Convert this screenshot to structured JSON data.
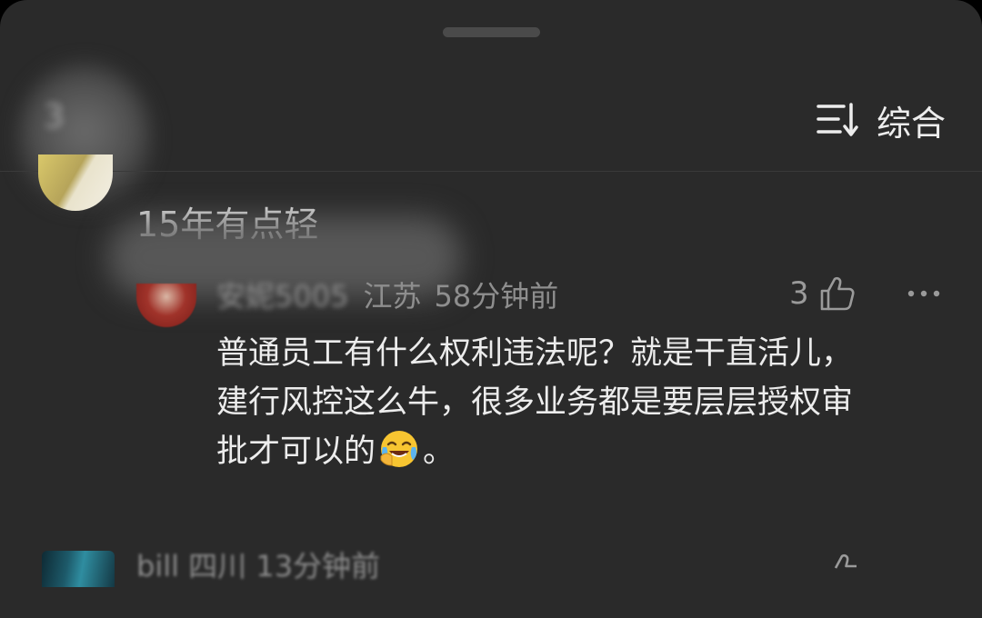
{
  "header": {
    "comment_count": "3",
    "sort_label": "综合",
    "sort_icon": "sort-icon"
  },
  "comment_1": {
    "text": "15年有点轻"
  },
  "reply": {
    "author": "安妮5005",
    "location": "江苏",
    "time": "58分钟前",
    "likes": "3",
    "text_line_1": "普通员工有什么权利违法呢？就是干直活儿，",
    "text_line_2": "建行风控这么牛，很多业务都是要层层授权审",
    "text_line_3a": "批才可以的",
    "text_line_3b": "。",
    "emoji": "face-with-tears-of-joy"
  },
  "next_comment": {
    "meta": "bill 四川 13分钟前"
  },
  "colors": {
    "background": "#2a2a2a",
    "primary_text": "#ececec",
    "secondary_text": "#8e8e8e"
  }
}
